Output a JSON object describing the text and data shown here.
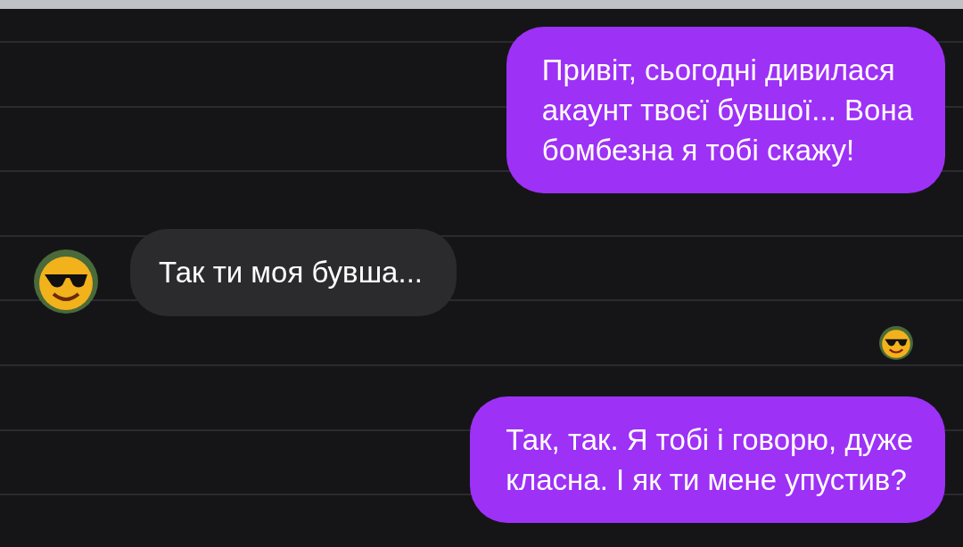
{
  "messages": [
    {
      "kind": "sent",
      "text": "Привіт, сьогодні дивилася\nакаунт твоєї бувшої... Вона\nбомбезна я тобі скажу!"
    },
    {
      "kind": "received",
      "text": "Так ти моя бувша..."
    },
    {
      "kind": "seen"
    },
    {
      "kind": "sent",
      "text": "Так, так. Я тобі і говорю, дуже\nкласна. І як ти мене упустив?"
    }
  ]
}
